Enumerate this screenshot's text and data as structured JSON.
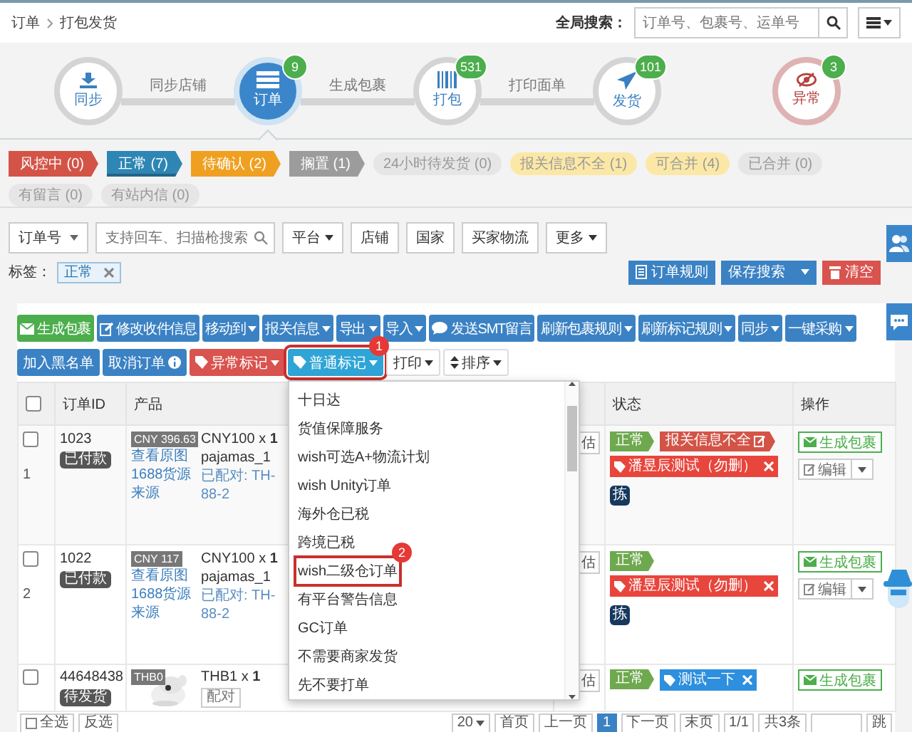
{
  "breadcrumb": [
    "订单",
    "打包发货"
  ],
  "global_search": {
    "label": "全局搜索：",
    "placeholder": "订单号、包裹号、运单号"
  },
  "steps": [
    {
      "label": "同步",
      "kind": "sync",
      "selected": false
    },
    {
      "label": "订单",
      "kind": "orders",
      "badge": "9",
      "selected": true
    },
    {
      "label": "打包",
      "kind": "pack",
      "badge": "531",
      "selected": false
    },
    {
      "label": "发货",
      "kind": "ship",
      "badge": "101",
      "selected": false
    },
    {
      "label": "异常",
      "kind": "alert",
      "badge": "3",
      "selected": false
    }
  ],
  "step_links": [
    "同步店铺",
    "生成包裹",
    "打印面单"
  ],
  "filters": [
    {
      "label": "风控中 (0)",
      "kind": "ribbon",
      "color": "#d35447",
      "selected": false
    },
    {
      "label": "正常 (7)",
      "kind": "ribbon",
      "color": "#2e86b5",
      "selected": true
    },
    {
      "label": "待确认 (2)",
      "kind": "ribbon",
      "color": "#f0a020",
      "selected": false
    },
    {
      "label": "搁置 (1)",
      "kind": "ribbon",
      "color": "#9c9c9c",
      "selected": false
    },
    {
      "label": "24小时待发货 (0)",
      "kind": "pill",
      "color": "#e6e6e6",
      "selected": false
    },
    {
      "label": "报关信息不全 (1)",
      "kind": "pill",
      "color": "#fce8a6",
      "selected": false
    },
    {
      "label": "可合并 (4)",
      "kind": "pill",
      "color": "#fce8a6",
      "selected": false
    },
    {
      "label": "已合并 (0)",
      "kind": "pill",
      "color": "#e6e6e6",
      "selected": false
    },
    {
      "label": "有留言 (0)",
      "kind": "pill",
      "color": "#e6e6e6",
      "selected": false
    },
    {
      "label": "有站内信 (0)",
      "kind": "pill",
      "color": "#e6e6e6",
      "selected": false
    }
  ],
  "search": {
    "field": "订单号",
    "placeholder": "支持回车、扫描枪搜索",
    "filters": [
      {
        "label": "平台",
        "dropdown": true
      },
      {
        "label": "店铺",
        "dropdown": false
      },
      {
        "label": "国家",
        "dropdown": false
      },
      {
        "label": "买家物流",
        "dropdown": false
      },
      {
        "label": "更多",
        "dropdown": true
      }
    ]
  },
  "tag_filter": {
    "label": "标签：",
    "tags": [
      "正常"
    ]
  },
  "search_actions": [
    {
      "label": "订单规则",
      "kind": "rules"
    },
    {
      "label": "保存搜索",
      "kind": "save"
    },
    {
      "label": "清空",
      "kind": "clear"
    }
  ],
  "toolbar": [
    [
      {
        "label": "生成包裹",
        "kind": "green",
        "dropdown": false
      },
      {
        "label": "修改收件信息",
        "kind": "blue",
        "dropdown": false
      },
      {
        "label": "移动到",
        "kind": "blue",
        "dropdown": true,
        "expanded": false
      },
      {
        "label": "报关信息",
        "kind": "blue",
        "dropdown": true,
        "expanded": false
      },
      {
        "label": "导出",
        "kind": "blue",
        "dropdown": true,
        "expanded": false
      },
      {
        "label": "导入",
        "kind": "blue",
        "dropdown": true,
        "expanded": false
      },
      {
        "label": "发送SMT留言",
        "kind": "blue",
        "dropdown": false
      },
      {
        "label": "刷新包裹规则",
        "kind": "blue",
        "dropdown": true,
        "expanded": false
      },
      {
        "label": "刷新标记规则",
        "kind": "blue",
        "dropdown": true,
        "expanded": false
      },
      {
        "label": "同步",
        "kind": "blue",
        "dropdown": true,
        "expanded": false
      },
      {
        "label": "一键采购",
        "kind": "blue",
        "dropdown": true,
        "expanded": false
      }
    ],
    [
      {
        "label": "加入黑名单",
        "kind": "blue",
        "dropdown": false
      },
      {
        "label": "取消订单",
        "kind": "blue",
        "dropdown": false
      },
      {
        "label": "异常标记",
        "kind": "red",
        "dropdown": true,
        "expanded": false
      },
      {
        "label": "普通标记",
        "kind": "cyan",
        "dropdown": true,
        "expanded": true,
        "marker": "1"
      },
      {
        "label": "打印",
        "kind": "plain",
        "dropdown": true,
        "expanded": false
      },
      {
        "label": "排序",
        "kind": "plain",
        "dropdown": true,
        "expanded": false
      }
    ]
  ],
  "dropdown": {
    "items": [
      {
        "label": "十日达",
        "selected": false
      },
      {
        "label": "货值保障服务",
        "selected": false
      },
      {
        "label": "wish可选A+物流计划",
        "selected": false
      },
      {
        "label": "wish Unity订单",
        "selected": false
      },
      {
        "label": "海外仓已税",
        "selected": false
      },
      {
        "label": "跨境已税",
        "selected": false
      },
      {
        "label": "wish二级仓订单",
        "selected": true,
        "marker": "2"
      },
      {
        "label": "有平台警告信息",
        "selected": false
      },
      {
        "label": "GC订单",
        "selected": false
      },
      {
        "label": "不需要商家发货",
        "selected": false
      },
      {
        "label": "先不要打单",
        "selected": false
      }
    ]
  },
  "table": {
    "all_checked": false,
    "columns": [
      "订单ID",
      "产品",
      "状态",
      "操作"
    ],
    "rows": [
      {
        "checked": false,
        "index": "1",
        "id": "1023",
        "state": "已付款",
        "price": "CNY 396.63",
        "links": [
          "查看原图",
          "1688货源",
          "来源"
        ],
        "item": "CNY100 x **1**",
        "sku": "pajamas_1",
        "pairing": [
          "已配对: TH-",
          "88-2"
        ],
        "estimate": "估",
        "statuses": [
          {
            "label": "正常",
            "kind": "ok"
          },
          {
            "label": "报关信息不全",
            "kind": "error"
          }
        ],
        "tags": [
          {
            "label": "潘昱辰测试（勿删）",
            "color": "#e8453c"
          }
        ],
        "pick": "拣",
        "actions": [
          "生成包裹",
          "编辑"
        ]
      },
      {
        "checked": false,
        "index": "2",
        "id": "1022",
        "state": "已付款",
        "price": "CNY 117",
        "links": [
          "查看原图",
          "1688货源",
          "来源"
        ],
        "item": "CNY100 x **1**",
        "sku": "pajamas_1",
        "pairing": [
          "已配对: TH-",
          "88-2"
        ],
        "estimate": "估",
        "statuses": [
          {
            "label": "正常",
            "kind": "ok"
          }
        ],
        "tags": [
          {
            "label": "潘昱辰测试（勿删）",
            "color": "#e8453c"
          }
        ],
        "pick": "拣",
        "actions": [
          "生成包裹",
          "编辑"
        ]
      },
      {
        "checked": false,
        "id": "44648438",
        "state": "待发货",
        "price": "THB0",
        "picture": {
          "kind": "picture"
        },
        "item": "THB1 x **1**",
        "pair_button": "配对",
        "estimate": "估",
        "statuses": [
          {
            "label": "正常",
            "kind": "ok"
          }
        ],
        "tags": [
          {
            "label": "测试一下",
            "color": "#2d8fdd"
          }
        ],
        "actions": [
          "生成包裹"
        ]
      }
    ]
  },
  "footer": {
    "select_all": "全选",
    "invert": "反选",
    "page_size": "20",
    "pages": [
      {
        "label": "首页",
        "selected": false
      },
      {
        "label": "上一页",
        "selected": false
      },
      {
        "label": "1",
        "selected": true
      },
      {
        "label": "下一页",
        "selected": false
      },
      {
        "label": "末页",
        "selected": false
      },
      {
        "label": "1/1",
        "selected": false
      },
      {
        "label": "共3条",
        "selected": false
      }
    ],
    "jump": "跳"
  }
}
